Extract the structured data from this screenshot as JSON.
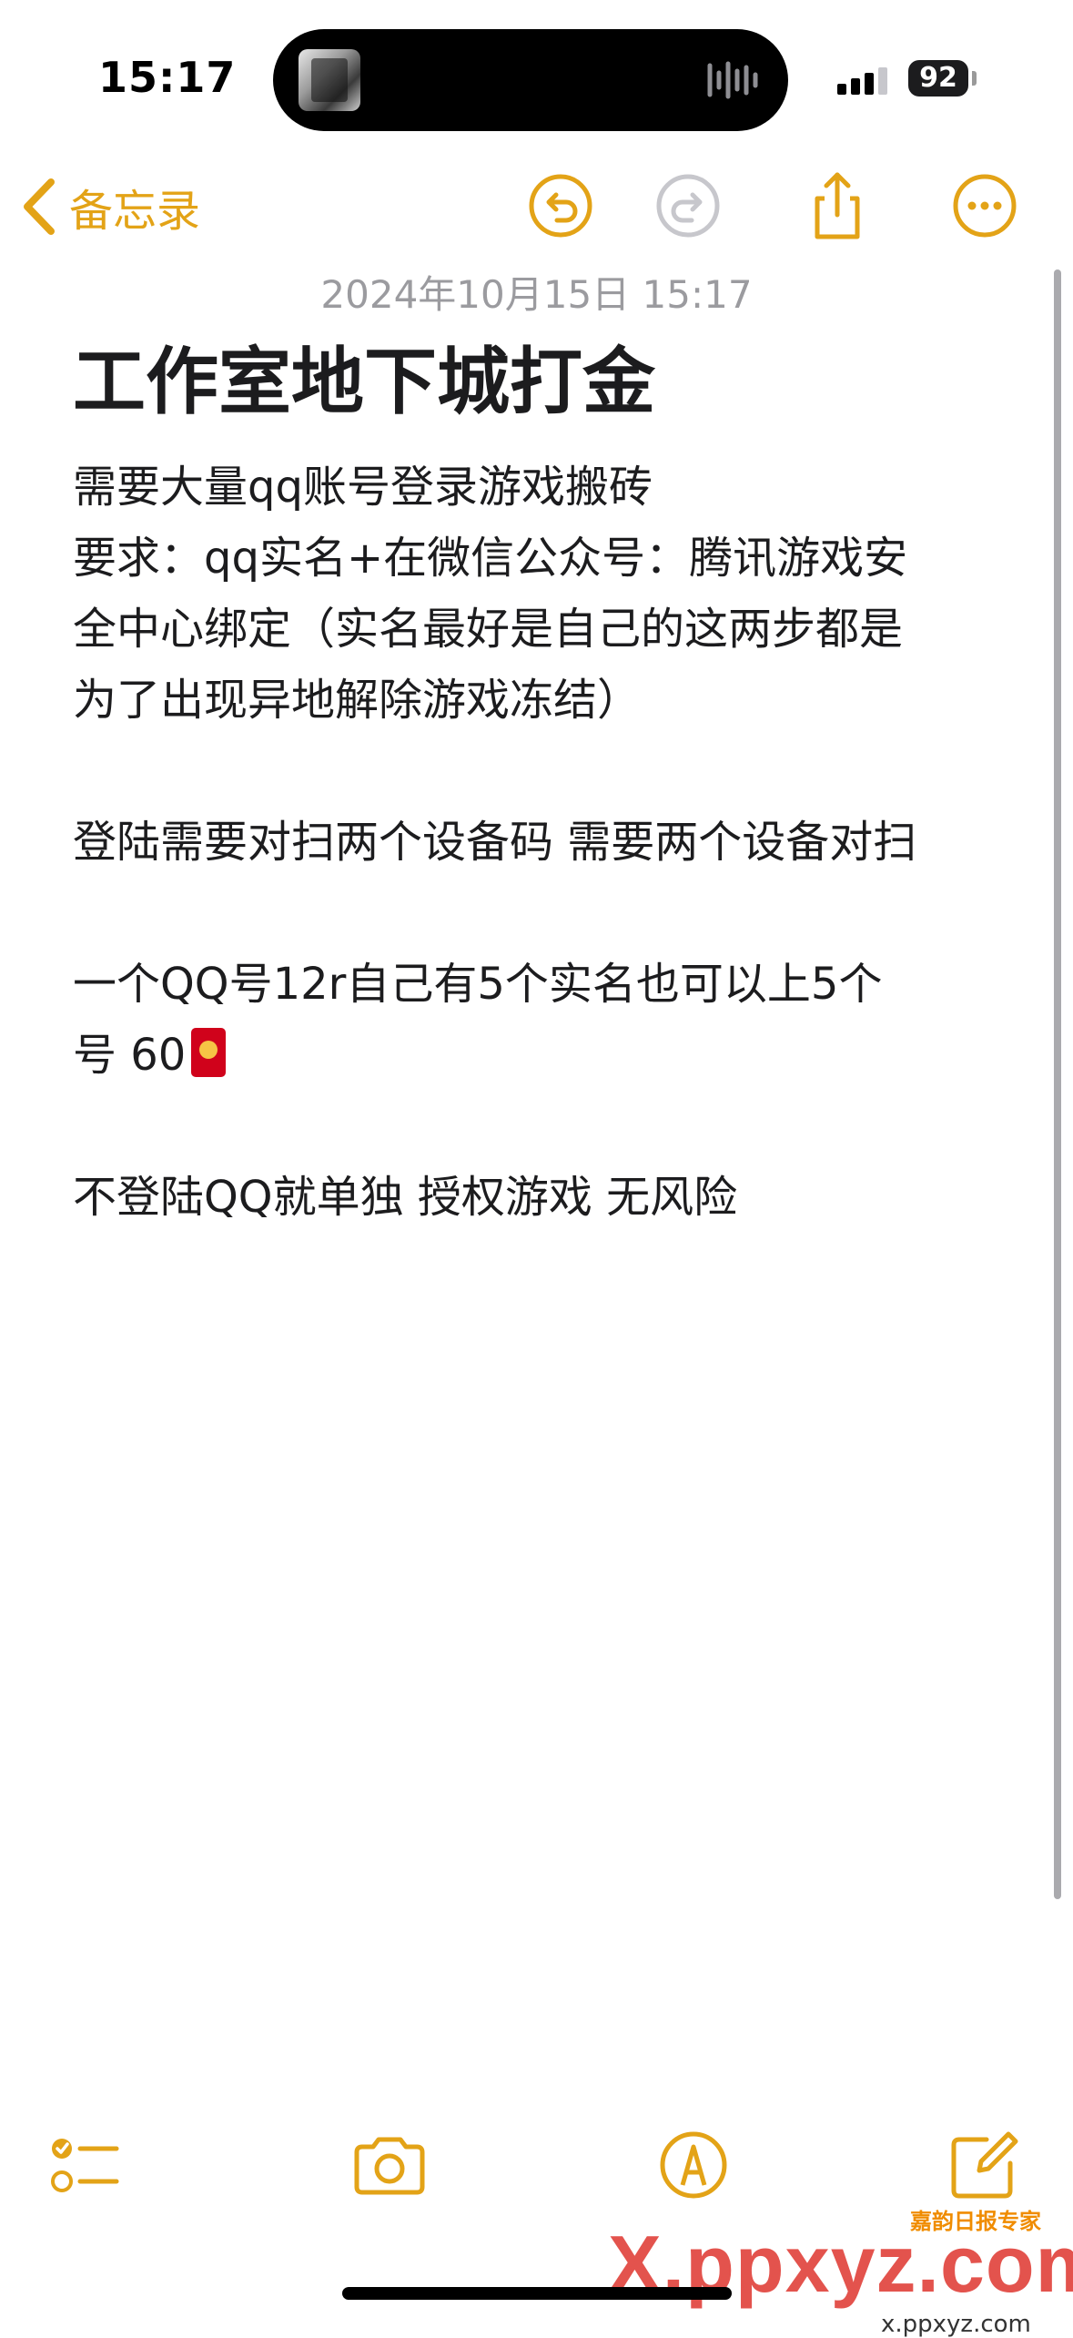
{
  "status_bar": {
    "time": "15:17",
    "battery": "92",
    "icons": [
      "now-playing-art-icon",
      "audio-waveform-icon",
      "cellular-signal-icon",
      "battery-icon"
    ]
  },
  "nav": {
    "back_label": "备忘录",
    "icons": [
      "chevron-left-icon",
      "undo-icon",
      "redo-icon",
      "share-icon",
      "more-icon"
    ],
    "accent_color": "#e3a317",
    "disabled_color": "#c7c7cc"
  },
  "note": {
    "date": "2024年10月15日 15:17",
    "title": "工作室地下城打金",
    "lines": [
      "需要大量qq账号登录游戏搬砖",
      "要求：qq实名+在微信公众号：腾讯游戏安",
      "全中心绑定（实名最好是自己的这两步都是",
      "为了出现异地解除游戏冻结）",
      "登陆需要对扫两个设备码 需要两个设备对扫",
      "一个QQ号12r自己有5个实名也可以上5个",
      "号 60",
      "不登陆QQ就单独 授权游戏 无风险"
    ],
    "emoji": "red-envelope-icon"
  },
  "toolbar": {
    "icons": [
      "checklist-icon",
      "camera-icon",
      "markup-pen-icon",
      "compose-icon"
    ]
  },
  "watermark": {
    "main": "X.ppxyz.com",
    "badge": "嘉韵日报专家",
    "sub": "x.ppxyz.com"
  }
}
